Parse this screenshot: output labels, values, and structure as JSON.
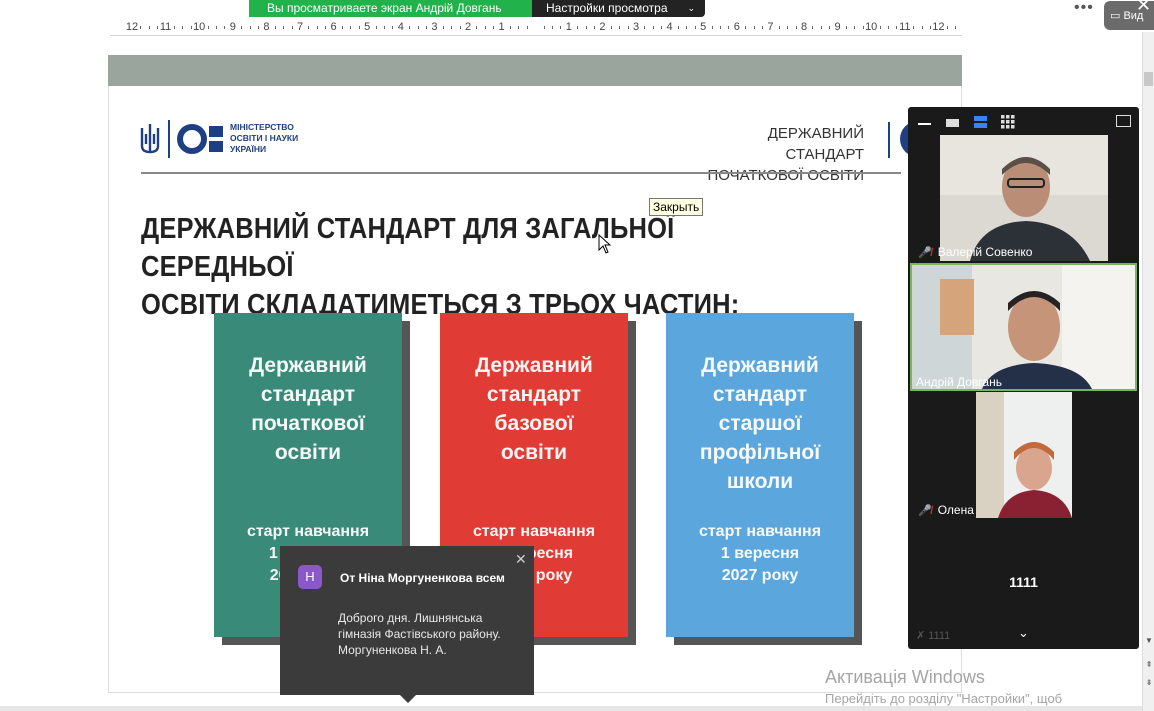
{
  "share_banner": {
    "viewing_text": "Вы просматриваете экран Андрій Довгань",
    "view_settings_label": "Настройки просмотра",
    "chevron_icon": "chevron-down-icon"
  },
  "ruler": {
    "labels": [
      "12",
      "11",
      "10",
      "9",
      "8",
      "7",
      "6",
      "5",
      "4",
      "3",
      "2",
      "1",
      "",
      "1",
      "2",
      "3",
      "4",
      "5",
      "6",
      "7",
      "8",
      "9",
      "10",
      "11",
      "12"
    ]
  },
  "slide": {
    "ministry_text": "МІНІСТЕРСТВО ОСВІТИ І НАУКИ УКРАЇНИ",
    "standard_top_line1": "ДЕРЖАВНИЙ СТАНДАРТ",
    "standard_top_line2": "ПОЧАТКОВОЇ ОСВІТИ",
    "heading_line1": "ДЕРЖАВНИЙ СТАНДАРТ ДЛЯ ЗАГАЛЬНОЇ СЕРЕДНЬОЇ",
    "heading_line2": "ОСВІТИ СКЛАДАТИМЕТЬСЯ З ТРЬОХ ЧАСТИН:",
    "cards": [
      {
        "title_lines": [
          "Державний",
          "стандарт",
          "початкової",
          "освіти"
        ],
        "start_lines": [
          "старт навчання",
          "1 вересня",
          "2018 року"
        ],
        "color": "#3a8a7a"
      },
      {
        "title_lines": [
          "Державний",
          "стандарт",
          "базової",
          "освіти"
        ],
        "start_lines": [
          "старт навчання",
          "1 вересня",
          "2022 року"
        ],
        "color": "#e03c35"
      },
      {
        "title_lines": [
          "Державний",
          "стандарт",
          "старшої",
          "профільної",
          "школи"
        ],
        "start_lines": [
          "старт навчання",
          "1 вересня",
          "2027 року"
        ],
        "color": "#5ba6dc"
      }
    ]
  },
  "tooltip": {
    "text": "Закрыть"
  },
  "chat": {
    "avatar_letter": "Н",
    "from": "От Ніна Моргуненкова всем",
    "message": "Доброго дня. Лишнянська гімназія Фастівського району. Моргуненкова Н. А.",
    "close_icon": "close-icon"
  },
  "video_panel": {
    "participants": [
      {
        "name": "Валерій Совенко",
        "muted": true
      },
      {
        "name": "Андрій Довгань",
        "muted": false,
        "active": true
      },
      {
        "name": "Олена",
        "muted": true
      }
    ],
    "text_tile": "1111",
    "ghost_label": "1111",
    "chevron_icon": "chevron-down-icon"
  },
  "window_controls": {
    "view_label": "Вид",
    "more_icon": "ellipsis-icon",
    "close_icon": "close-icon"
  },
  "activation": {
    "title": "Активація Windows",
    "subtitle": "Перейдіть до розділу \"Настройки\", щоб"
  },
  "colors": {
    "share_green": "#22b24c",
    "dark": "#232323",
    "ministry_blue": "#1f3f85",
    "active_border": "#7ab55c",
    "mute_red": "#e03030"
  }
}
